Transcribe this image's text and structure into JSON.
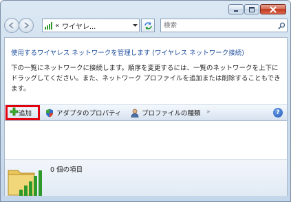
{
  "window": {
    "caption_buttons": [
      "minimize-icon",
      "maximize-icon",
      "close-icon"
    ]
  },
  "nav": {
    "breadcrumb_separator": "«",
    "address_text": "ワイヤレ...",
    "search": {
      "placeholder": "検索"
    }
  },
  "content": {
    "header_link": "使用するワイヤレス ネットワークを管理します (ワイヤレス ネットワーク接続)",
    "description": "下の一覧にネットワークに接続します。順序を変更するには、一覧のネットワークを上下にドラッグしてください。また、ネットワーク プロファイルを追加または削除することもできます。"
  },
  "commandbar": {
    "add_label": "追加",
    "adapter_label": "アダプタのプロパティ",
    "profile_type_label": "プロファイルの種類",
    "more_label": "»",
    "help_label": "?"
  },
  "details": {
    "item_count": "0 個の項目"
  },
  "colors": {
    "accent_link": "#1f4f9e",
    "highlight": "#e2000f",
    "wifi_green": "#2f9a2b"
  }
}
